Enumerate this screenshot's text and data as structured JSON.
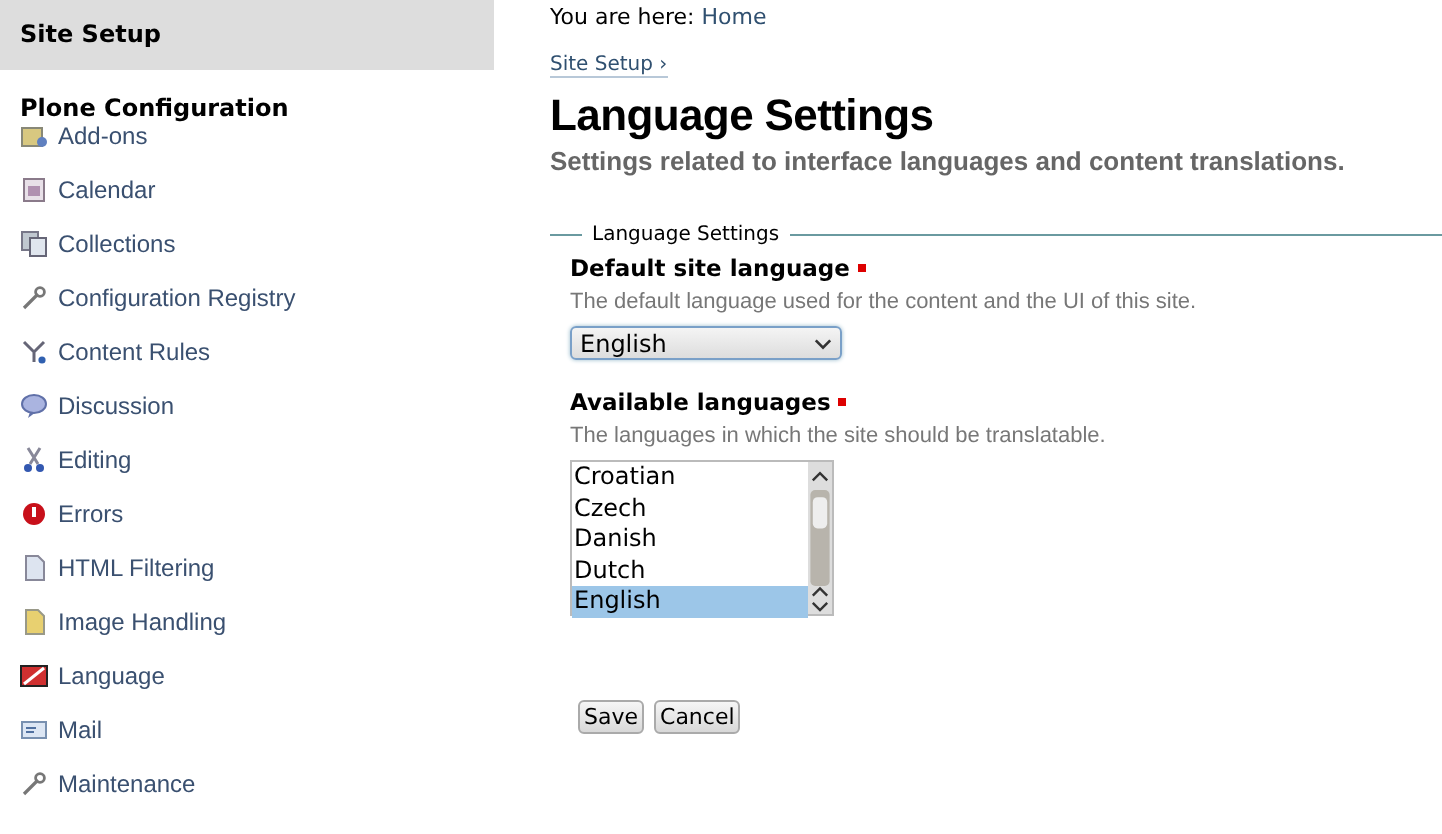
{
  "sidebar": {
    "title": "Site Setup",
    "section": "Plone Configuration",
    "items": [
      {
        "label": "Add-ons",
        "kind": "package"
      },
      {
        "label": "Calendar",
        "kind": "calendar"
      },
      {
        "label": "Collections",
        "kind": "stack"
      },
      {
        "label": "Configuration Registry",
        "kind": "wrench"
      },
      {
        "label": "Content Rules",
        "kind": "rules"
      },
      {
        "label": "Discussion",
        "kind": "bubble"
      },
      {
        "label": "Editing",
        "kind": "scissors"
      },
      {
        "label": "Errors",
        "kind": "error"
      },
      {
        "label": "HTML Filtering",
        "kind": "document"
      },
      {
        "label": "Image Handling",
        "kind": "image"
      },
      {
        "label": "Language",
        "kind": "flag"
      },
      {
        "label": "Mail",
        "kind": "mail"
      },
      {
        "label": "Maintenance",
        "kind": "wrench"
      }
    ]
  },
  "breadcrumb": {
    "prefix": "You are here:",
    "link": "Home"
  },
  "parent_link": "Site Setup ›",
  "title": "Language Settings",
  "description": "Settings related to interface languages and content translations.",
  "fieldset": {
    "legend": "Language Settings",
    "fields": [
      {
        "kind": "select",
        "label": "Default site language",
        "required": true,
        "help": "The default language used for the content and the UI of this site.",
        "value": "English"
      },
      {
        "kind": "list",
        "label": "Available languages",
        "required": true,
        "help": "The languages in which the site should be translatable.",
        "options": [
          {
            "label": "Croatian",
            "selected": false
          },
          {
            "label": "Czech",
            "selected": false
          },
          {
            "label": "Danish",
            "selected": false
          },
          {
            "label": "Dutch",
            "selected": false
          },
          {
            "label": "English",
            "selected": true
          }
        ]
      }
    ]
  },
  "buttons": [
    "Save",
    "Cancel"
  ]
}
